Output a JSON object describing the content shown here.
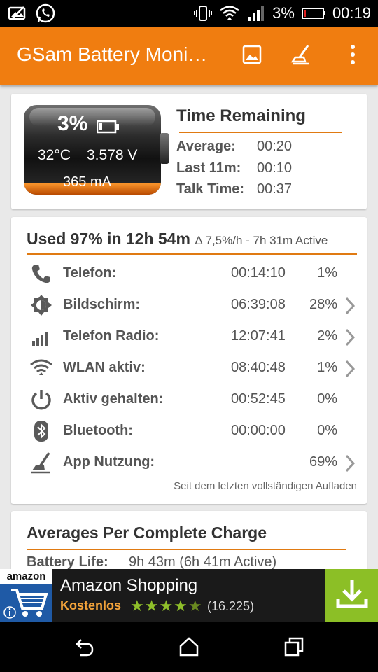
{
  "status_bar": {
    "battery_percent": "3%",
    "time": "00:19",
    "icons": [
      "image-icon",
      "whatsapp-icon",
      "vibrate-icon",
      "wifi-icon",
      "signal-icon",
      "battery-icon"
    ]
  },
  "app_bar": {
    "title": "GSam Battery Moni…",
    "actions": [
      "image-icon",
      "broom-icon",
      "overflow-menu-icon"
    ]
  },
  "battery_card": {
    "percent": "3%",
    "temperature": "32°C",
    "voltage": "3.578 V",
    "current": "365 mA",
    "fill_level": 0.03
  },
  "time_remaining": {
    "title": "Time Remaining",
    "rows": [
      {
        "label": "Average:",
        "value": "00:20"
      },
      {
        "label": "Last 11m:",
        "value": "00:10"
      },
      {
        "label": "Talk Time:",
        "value": "00:37"
      }
    ]
  },
  "usage": {
    "title": "Used 97% in 12h 54m",
    "subtitle": "Δ 7,5%/h - 7h 31m Active",
    "rows": [
      {
        "icon": "phone-icon",
        "name": "Telefon:",
        "time": "00:14:10",
        "percent": "1%",
        "chevron": false
      },
      {
        "icon": "brightness-icon",
        "name": "Bildschirm:",
        "time": "06:39:08",
        "percent": "28%",
        "chevron": true
      },
      {
        "icon": "signal-bars-icon",
        "name": "Telefon Radio:",
        "time": "12:07:41",
        "percent": "2%",
        "chevron": true
      },
      {
        "icon": "wifi-icon",
        "name": "WLAN aktiv:",
        "time": "08:40:48",
        "percent": "1%",
        "chevron": true
      },
      {
        "icon": "power-icon",
        "name": "Aktiv gehalten:",
        "time": "00:52:45",
        "percent": "0%",
        "chevron": false
      },
      {
        "icon": "bluetooth-icon",
        "name": "Bluetooth:",
        "time": "00:00:00",
        "percent": "0%",
        "chevron": false
      },
      {
        "icon": "broom-icon",
        "name": "App Nutzung:",
        "time": "",
        "percent": "69%",
        "chevron": true
      }
    ],
    "footnote": "Seit dem letzten vollständigen Aufladen"
  },
  "averages": {
    "title": "Averages Per Complete Charge",
    "rows": [
      {
        "label": "Battery Life:",
        "value": "9h 43m (6h 41m Active)"
      }
    ]
  },
  "ad": {
    "brand": "amazon",
    "title": "Amazon Shopping",
    "subtitle": "Kostenlos",
    "rating": 4.5,
    "reviews": "(16.225)"
  },
  "nav_bar": {
    "buttons": [
      "back-icon",
      "home-icon",
      "recents-icon"
    ]
  },
  "colors": {
    "accent": "#f07d10",
    "rule": "#e07a12",
    "ad_download": "#8cbf26"
  }
}
